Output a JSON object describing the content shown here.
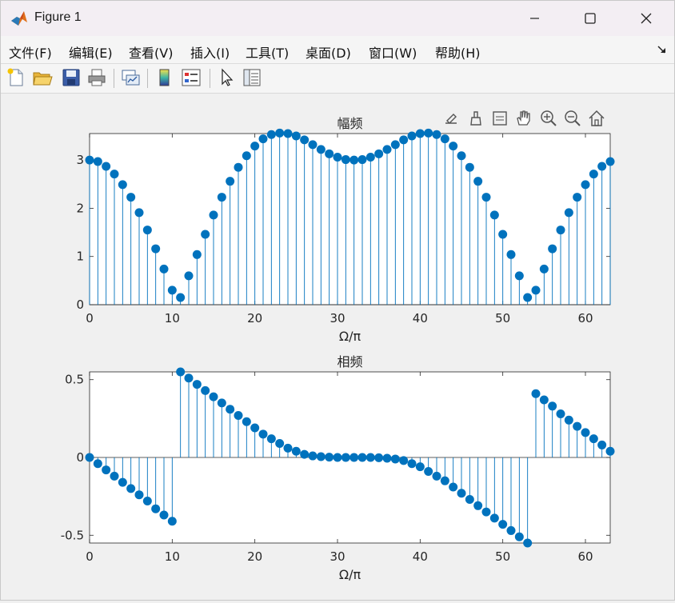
{
  "window": {
    "title": "Figure 1"
  },
  "menu": [
    "文件(F)",
    "编辑(E)",
    "查看(V)",
    "插入(I)",
    "工具(T)",
    "桌面(D)",
    "窗口(W)",
    "帮助(H)"
  ],
  "toolbar": [
    "new-figure-icon",
    "open-file-icon",
    "save-icon",
    "print-icon",
    "link-plot-icon",
    "colorbar-icon",
    "legend-icon",
    "edit-plot-icon",
    "property-inspector-icon"
  ],
  "axes_toolbar": [
    "data-tips-icon",
    "brush-icon",
    "data-cursor-icon",
    "pan-icon",
    "zoom-in-icon",
    "zoom-out-icon",
    "home-icon"
  ],
  "colors": {
    "stem": "#0072bd"
  },
  "chart_data": [
    {
      "type": "stem",
      "title": "幅频",
      "xlabel": "Ω/π",
      "xlim": [
        0,
        63
      ],
      "ylim": [
        0,
        3.55
      ],
      "xticks": [
        "0",
        "10",
        "20",
        "30",
        "40",
        "50",
        "60"
      ],
      "yticks": [
        "0",
        "1",
        "2",
        "3"
      ],
      "x": [
        0,
        1,
        2,
        3,
        4,
        5,
        6,
        7,
        8,
        9,
        10,
        11,
        12,
        13,
        14,
        15,
        16,
        17,
        18,
        19,
        20,
        21,
        22,
        23,
        24,
        25,
        26,
        27,
        28,
        29,
        30,
        31,
        32,
        33,
        34,
        35,
        36,
        37,
        38,
        39,
        40,
        41,
        42,
        43,
        44,
        45,
        46,
        47,
        48,
        49,
        50,
        51,
        52,
        53,
        54,
        55,
        56,
        57,
        58,
        59,
        60,
        61,
        62,
        63
      ],
      "values": [
        3.0,
        2.97,
        2.87,
        2.71,
        2.49,
        2.23,
        1.91,
        1.55,
        1.16,
        0.74,
        0.3,
        0.15,
        0.6,
        1.04,
        1.46,
        1.86,
        2.23,
        2.56,
        2.85,
        3.09,
        3.29,
        3.44,
        3.53,
        3.56,
        3.55,
        3.5,
        3.42,
        3.32,
        3.22,
        3.13,
        3.06,
        3.01,
        3.0,
        3.01,
        3.06,
        3.13,
        3.22,
        3.32,
        3.42,
        3.5,
        3.55,
        3.56,
        3.53,
        3.44,
        3.29,
        3.09,
        2.85,
        2.56,
        2.23,
        1.86,
        1.46,
        1.04,
        0.6,
        0.15,
        0.3,
        0.74,
        1.16,
        1.55,
        1.91,
        2.23,
        2.49,
        2.71,
        2.87,
        2.97
      ]
    },
    {
      "type": "stem",
      "title": "相频",
      "xlabel": "Ω/π",
      "xlim": [
        0,
        63
      ],
      "ylim": [
        -0.55,
        0.55
      ],
      "xticks": [
        "0",
        "10",
        "20",
        "30",
        "40",
        "50",
        "60"
      ],
      "yticks": [
        "-0.5",
        "0",
        "0.5"
      ],
      "x": [
        0,
        1,
        2,
        3,
        4,
        5,
        6,
        7,
        8,
        9,
        10,
        11,
        12,
        13,
        14,
        15,
        16,
        17,
        18,
        19,
        20,
        21,
        22,
        23,
        24,
        25,
        26,
        27,
        28,
        29,
        30,
        31,
        32,
        33,
        34,
        35,
        36,
        37,
        38,
        39,
        40,
        41,
        42,
        43,
        44,
        45,
        46,
        47,
        48,
        49,
        50,
        51,
        52,
        53,
        54,
        55,
        56,
        57,
        58,
        59,
        60,
        61,
        62,
        63
      ],
      "values": [
        0,
        -0.04,
        -0.08,
        -0.12,
        -0.16,
        -0.2,
        -0.24,
        -0.28,
        -0.33,
        -0.37,
        -0.41,
        0.55,
        0.51,
        0.47,
        0.43,
        0.39,
        0.35,
        0.31,
        0.27,
        0.23,
        0.19,
        0.15,
        0.12,
        0.09,
        0.06,
        0.04,
        0.02,
        0.01,
        0.005,
        0.002,
        0.0,
        0.0,
        0.0,
        0.0,
        0.0,
        -0.002,
        -0.005,
        -0.01,
        -0.02,
        -0.04,
        -0.06,
        -0.09,
        -0.12,
        -0.15,
        -0.19,
        -0.23,
        -0.27,
        -0.31,
        -0.35,
        -0.39,
        -0.43,
        -0.47,
        -0.51,
        -0.55,
        0.41,
        0.37,
        0.33,
        0.28,
        0.24,
        0.2,
        0.16,
        0.12,
        0.08,
        0.04
      ]
    }
  ]
}
